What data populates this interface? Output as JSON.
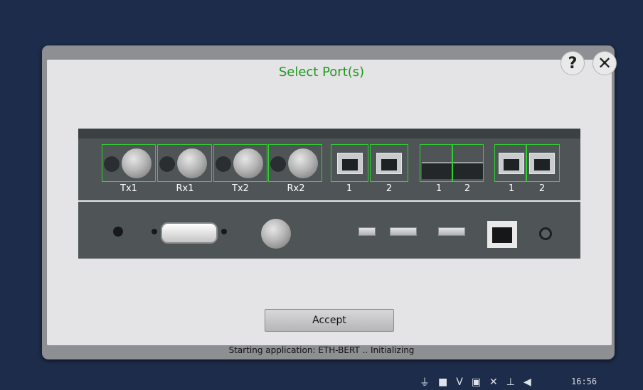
{
  "dialog": {
    "title": "Select Port(s)",
    "help_label": "?",
    "close_label": "✕",
    "accept_label": "Accept",
    "status_text": "Starting application: ETH-BERT .. Initializing"
  },
  "ports": {
    "bnc_labels": [
      "Tx1",
      "Rx1",
      "Tx2",
      "Rx2"
    ],
    "rj45_group1_labels": [
      "1",
      "2"
    ],
    "sfp_labels": [
      "1",
      "2"
    ],
    "rj45_group2_labels": [
      "1",
      "2"
    ]
  },
  "taskbar": {
    "icons": [
      "plug-icon",
      "storage-icon",
      "v-icon",
      "terminal-icon",
      "satellite-icon",
      "network-icon",
      "volume-icon"
    ],
    "tray_v": "V",
    "clock": "16:56"
  },
  "colors": {
    "title_green": "#1f9a1f",
    "port_highlight": "#2fd12f",
    "desktop": "#1c2c4a"
  }
}
